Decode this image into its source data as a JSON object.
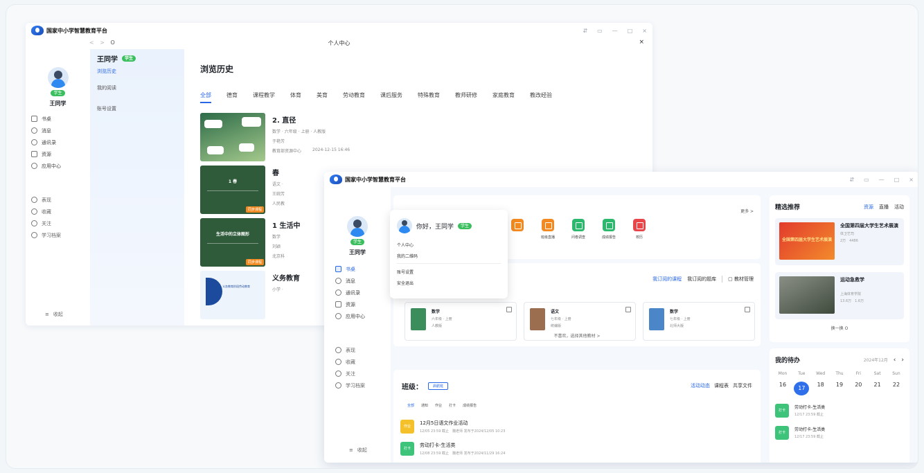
{
  "app": {
    "name": "国家中小学智慧教育平台"
  },
  "window1": {
    "page_title": "个人中心",
    "nav_arrows": "< >",
    "nav_refresh": "O",
    "close": "×",
    "user": {
      "name": "王同学",
      "tag": "学生"
    },
    "left_nav": [
      {
        "label": "书桌"
      },
      {
        "label": "消息"
      },
      {
        "label": "通讯录"
      },
      {
        "label": "资源"
      },
      {
        "label": "应用中心"
      },
      {
        "label": "表现"
      },
      {
        "label": "收藏"
      },
      {
        "label": "关注"
      },
      {
        "label": "学习档案"
      }
    ],
    "collapse": "收起",
    "sub_nav": {
      "name": "王同学",
      "tag": "学生",
      "items": [
        "浏览历史",
        "我的阅读",
        "账号设置"
      ]
    },
    "main": {
      "heading": "浏览历史",
      "tabs": [
        "全部",
        "德育",
        "课程教学",
        "体育",
        "美育",
        "劳动教育",
        "课后服务",
        "特殊教育",
        "教师研修",
        "家庭教育",
        "教改经验"
      ],
      "items": [
        {
          "title": "2. 直径",
          "subject": "数学 · 六年级 · 上册 · 人教版",
          "teacher": "于艳芳",
          "source": "教育部资源中心",
          "date": "2024-12-15 16:46"
        },
        {
          "title": "春",
          "subject": "语文 ·",
          "teacher": "王婉芳",
          "source": "人民教",
          "thumb_text": "1 春",
          "badge": "同步课程"
        },
        {
          "title": "1 生活中",
          "subject": "数学",
          "teacher": "刘颖",
          "source": "北京科",
          "thumb_text": "生活中的立体图形",
          "badge": "同步课程"
        },
        {
          "title": "义务教育",
          "subject": "小学 ·",
          "thumb_text": "义务教育阶段劳动教育"
        }
      ]
    }
  },
  "window2": {
    "user": {
      "name": "王同学",
      "tag": "学生"
    },
    "left_nav": [
      {
        "label": "书桌"
      },
      {
        "label": "消息"
      },
      {
        "label": "通讯录"
      },
      {
        "label": "资源"
      },
      {
        "label": "应用中心"
      },
      {
        "label": "表现"
      },
      {
        "label": "收藏"
      },
      {
        "label": "关注"
      },
      {
        "label": "学习档案"
      }
    ],
    "collapse": "收起",
    "popup": {
      "greeting": "你好，王同学",
      "tag": "学生",
      "items": [
        "个人中心",
        "我的二维码",
        "账号设置",
        "安全退出"
      ]
    },
    "apps": [
      {
        "label": "",
        "color": "#f28a21"
      },
      {
        "label": "班级直播",
        "color": "#f28a21"
      },
      {
        "label": "问卷调查",
        "color": "#2cb96d"
      },
      {
        "label": "成绩报告",
        "color": "#2cb96d"
      },
      {
        "label": "校历",
        "color": "#e8464b"
      }
    ],
    "more": "更多 >",
    "course": {
      "links": [
        "我订阅的课程",
        "我订阅的题库",
        "教材管理"
      ],
      "books": [
        {
          "title": "数学",
          "grade": "六年级 · 上册",
          "publisher": "人教版",
          "color": "#3c8d5c"
        },
        {
          "title": "语文",
          "grade": "七年级 · 上册",
          "publisher": "统编版",
          "color": "#9b6e4f"
        },
        {
          "title": "数学",
          "grade": "七年级 · 上册",
          "publisher": "北师大版",
          "color": "#4a86c8"
        }
      ],
      "dislike": "不喜欢，选择其他教材 >"
    },
    "class": {
      "label": "班级：",
      "button": "启航班",
      "links": [
        "活动动态",
        "课程表",
        "共享文件"
      ],
      "tabs": [
        "全部",
        "通知",
        "作业",
        "打卡",
        "成绩报告"
      ],
      "tasks": [
        {
          "tag": "作业",
          "title": "12月5日语文作业活动",
          "sub": "12/05 23:59 截止　魏老师 发布于2024/12/05 10:23",
          "color": "#f5c12a"
        },
        {
          "tag": "打卡",
          "title": "劳动打卡-生活类",
          "sub": "12/08 23:59 截止　魏老师 发布于2024/11/29 16:24",
          "color": "#3ec47a"
        }
      ]
    },
    "rec": {
      "title": "精选推荐",
      "tabs": [
        "资源",
        "直播",
        "活动"
      ],
      "cards": [
        {
          "title": "全国第四届大学生艺术展演",
          "src": "体卫艺司",
          "stats": "2万　4486",
          "img_text": "全国第四届大学生艺术展演"
        },
        {
          "title": "运动急救学",
          "src": "上海体育学院",
          "stats": "13.6万　1.6万",
          "img_text": ""
        }
      ],
      "swap": "换一换 O"
    },
    "todo": {
      "title": "我的待办",
      "date": "2024年12月",
      "week": [
        "Mon",
        "Tue",
        "Wed",
        "Thu",
        "Fri",
        "Sat",
        "Sun"
      ],
      "days": [
        "16",
        "17",
        "18",
        "19",
        "20",
        "21",
        "22"
      ],
      "selected_day": "17",
      "items": [
        {
          "tag": "打卡",
          "title": "劳动打卡-生活类",
          "sub": "12/17 23:59 截止"
        },
        {
          "tag": "打卡",
          "title": "劳动打卡-生活类",
          "sub": "12/17 23:59 截止"
        }
      ]
    }
  }
}
